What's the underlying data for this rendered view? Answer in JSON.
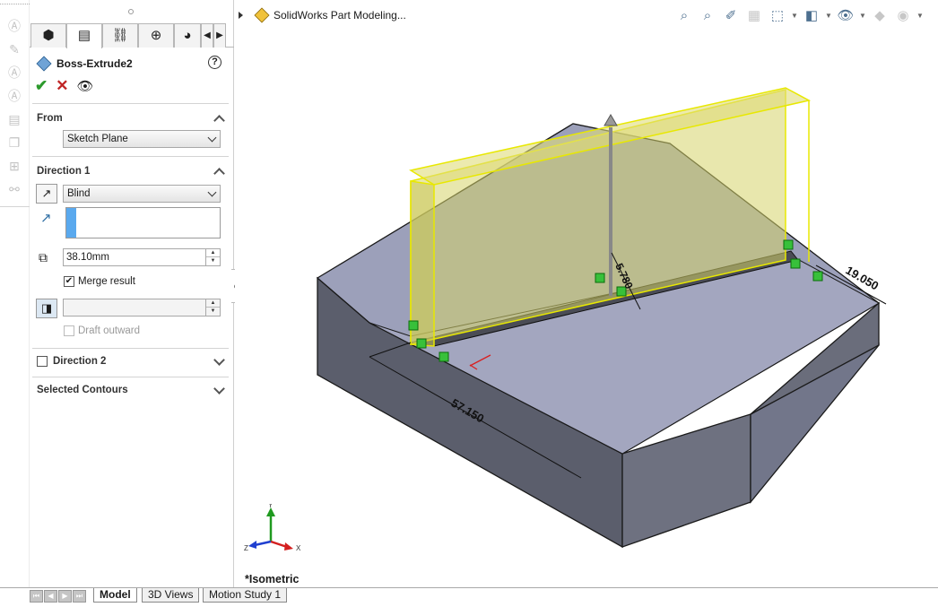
{
  "left_toolbar": {
    "icons": [
      "smart-dimension-icon",
      "annotation-icon",
      "note-icon",
      "balloon-icon",
      "stack-icon",
      "copy-icon",
      "grid-icon",
      "link-icon"
    ]
  },
  "property_manager": {
    "tabs": [
      "featuremanager-icon",
      "propertymanager-icon",
      "configurationmanager-icon",
      "dimxpert-icon",
      "appearance-icon"
    ],
    "title": "Boss-Extrude2",
    "help": "?",
    "from": {
      "label": "From",
      "value": "Sketch Plane"
    },
    "direction1": {
      "label": "Direction 1",
      "end_condition": "Blind",
      "depth": "38.10mm",
      "merge_result_label": "Merge result",
      "merge_result_checked": true,
      "draft_outward_label": "Draft outward",
      "draft_angle": ""
    },
    "direction2": {
      "label": "Direction 2",
      "checked": false
    },
    "selected_contours": {
      "label": "Selected Contours"
    }
  },
  "viewport": {
    "tree_root": "SolidWorks Part Modeling...",
    "view_name": "*Isometric",
    "dimensions": [
      "57.150",
      "19.050",
      "5.780"
    ],
    "triad": {
      "x": "X",
      "y": "Y",
      "z": "Z"
    },
    "colors": {
      "preview_fill": "#d6d36a",
      "preview_edge": "#e8e800",
      "body_top": "#9ca0ba",
      "body_side": "#5b5e6c"
    }
  },
  "bottom_tabs": [
    "Model",
    "3D Views",
    "Motion Study 1"
  ]
}
